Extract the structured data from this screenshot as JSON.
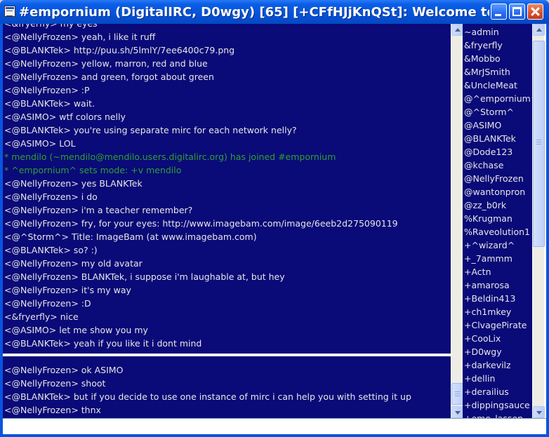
{
  "window": {
    "title": "#empornium (DigitalIRC, D0wgy) [65] [+CFfHJjKnQSt]: Welcome to #em..."
  },
  "chat": {
    "top_lines": [
      {
        "text": "<&fryerfly> my eyes",
        "kind": "msg"
      },
      {
        "text": "<@NellyFrozen> yeah, i like it ruff",
        "kind": "msg"
      },
      {
        "text": "<@BLANKTek> http://puu.sh/5lmlY/7ee6400c79.png",
        "kind": "msg"
      },
      {
        "text": "<@NellyFrozen> yellow, marron, red and blue",
        "kind": "msg"
      },
      {
        "text": "<@NellyFrozen> and green, forgot about green",
        "kind": "msg"
      },
      {
        "text": "<@NellyFrozen> :P",
        "kind": "msg"
      },
      {
        "text": "<@BLANKTek> wait.",
        "kind": "msg"
      },
      {
        "text": "<@ASIMO> wtf colors nelly",
        "kind": "msg"
      },
      {
        "text": "<@BLANKTek> you're using separate mirc for each network nelly?",
        "kind": "msg"
      },
      {
        "text": "<@ASIMO> LOL",
        "kind": "msg"
      },
      {
        "text": "* mendilo (~mendilo@mendilo.users.digitalirc.org) has joined #empornium",
        "kind": "event"
      },
      {
        "text": "* ^empornium^ sets mode: +v mendilo",
        "kind": "event"
      },
      {
        "text": "<@NellyFrozen> yes BLANKTek",
        "kind": "msg"
      },
      {
        "text": "<@NellyFrozen> i do",
        "kind": "msg"
      },
      {
        "text": "<@NellyFrozen> i'm a teacher remember?",
        "kind": "msg"
      },
      {
        "text": "<@NellyFrozen> fry, for your eyes: http://www.imagebam.com/image/6eeb2d275090119",
        "kind": "msg"
      },
      {
        "text": "<@^Storm^> Title: ImageBam (at www.imagebam.com)",
        "kind": "msg"
      },
      {
        "text": "<@BLANKTek> so? :)",
        "kind": "msg"
      },
      {
        "text": "<@NellyFrozen> my old avatar",
        "kind": "msg"
      },
      {
        "text": "<@NellyFrozen> BLANKTek, i suppose i'm laughable at, but hey",
        "kind": "msg"
      },
      {
        "text": "<@NellyFrozen> it's my way",
        "kind": "msg"
      },
      {
        "text": "<@NellyFrozen> :D",
        "kind": "msg"
      },
      {
        "text": "<&fryerfly> nice",
        "kind": "msg"
      },
      {
        "text": "<@ASIMO> let me show you my",
        "kind": "msg"
      },
      {
        "text": "<@BLANKTek> yeah if you like it i dont mind",
        "kind": "msg"
      }
    ],
    "bottom_lines": [
      {
        "text": "<@NellyFrozen> ok ASIMO",
        "kind": "msg"
      },
      {
        "text": "<@NellyFrozen> shoot",
        "kind": "msg"
      },
      {
        "text": "<@BLANKTek> but if you decide to use one instance of mirc i can help you with setting it up",
        "kind": "msg"
      },
      {
        "text": "<@NellyFrozen> thnx",
        "kind": "msg"
      }
    ]
  },
  "nicklist": [
    "~admin",
    "&fryerfly",
    "&Mobbo",
    "&MrJSmith",
    "&UncleMeat",
    "@^empornium^",
    "@^Storm^",
    "@ASIMO",
    "@BLANKTek",
    "@Dode123",
    "@kchase",
    "@NellyFrozen",
    "@wantonpron",
    "@zz_b0rk",
    "%Krugman",
    "%Raveolution1",
    "+^wizard^",
    "+_7ammm",
    "+Actn",
    "+amarosa",
    "+Beldin413",
    "+ch1mkey",
    "+ClvagePirate",
    "+CooLix",
    "+D0wgy",
    "+darkevilz",
    "+dellin",
    "+derailius",
    "+dippingsauce",
    "+emo_lassen"
  ],
  "input": {
    "value": ""
  },
  "colors": {
    "background": "#0a0a78",
    "text": "#e6e6e6",
    "event": "#2fa02f",
    "titlebar": "#0552d8"
  }
}
